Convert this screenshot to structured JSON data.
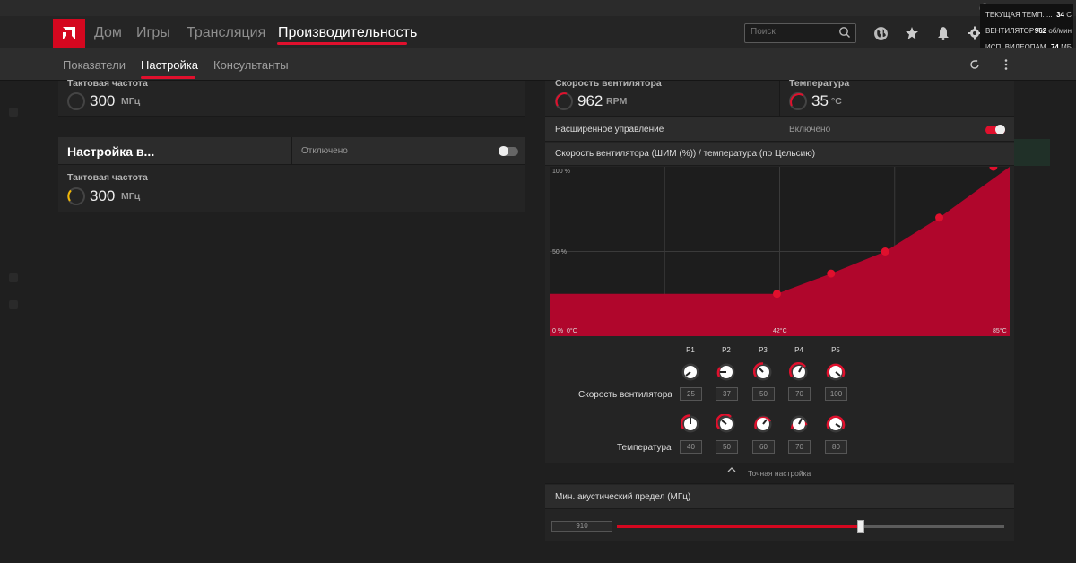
{
  "nav": {
    "items": [
      "Дом",
      "Игры",
      "Трансляция",
      "Производительность"
    ],
    "search_placeholder": "Поиск"
  },
  "overlay": {
    "rows": [
      {
        "label": "ТЕКУЩАЯ ТЕМП. ...",
        "value": "34",
        "unit": "C"
      },
      {
        "label": "ВЕНТИЛЯТОР Г...",
        "value": "962",
        "unit": "об/мин"
      },
      {
        "label": "ИСП. ВИДЕОПАМ...",
        "value": "74",
        "unit": "МБ"
      }
    ]
  },
  "subnav": {
    "items": [
      "Показатели",
      "Настройка",
      "Консультанты"
    ]
  },
  "left": {
    "panel1": {
      "label": "Тактовая частота",
      "value": "300",
      "unit": "МГц"
    },
    "panel2": {
      "title": "Настройка в...",
      "status": "Отключено",
      "label": "Тактовая частота",
      "value": "300",
      "unit": "МГц"
    }
  },
  "right": {
    "fan_speed": {
      "label": "Скорость вентилятора",
      "value": "962",
      "unit": "RPM"
    },
    "temperature": {
      "label": "Температура",
      "value": "35",
      "unit": "°C"
    },
    "advanced": {
      "label": "Расширенное управление",
      "status": "Включено"
    },
    "chart_title": "Скорость вентилятора (ШИМ (%)) / температура (по Цельсию)",
    "fine_tune": "Точная настройка",
    "min_acoustic": {
      "label": "Мин. акустический предел (МГц)",
      "value": "910",
      "fraction": 0.63
    },
    "points_header": [
      "P1",
      "P2",
      "P3",
      "P4",
      "P5"
    ],
    "fan_row_label": "Скорость вентилятора",
    "temp_row_label": "Температура",
    "fan_values": [
      "25",
      "37",
      "50",
      "70",
      "100"
    ],
    "temp_values": [
      "40",
      "50",
      "60",
      "70",
      "80"
    ]
  },
  "chart_data": {
    "type": "area",
    "x": [
      0,
      42,
      52,
      62,
      72,
      85
    ],
    "y": [
      25,
      25,
      37,
      50,
      70,
      100
    ],
    "points": [
      {
        "x": 42,
        "y": 25
      },
      {
        "x": 52,
        "y": 37
      },
      {
        "x": 62,
        "y": 50
      },
      {
        "x": 72,
        "y": 70
      },
      {
        "x": 82,
        "y": 100
      }
    ],
    "xlim": [
      0,
      85
    ],
    "ylim": [
      0,
      100
    ],
    "y_tick_labels": [
      "100 %",
      "50 %",
      "0 %"
    ],
    "x_tick_labels": [
      "0°C",
      "42°C",
      "85°C"
    ],
    "grid": true,
    "fill_color": "#b0062c",
    "point_color": "#e0102d"
  },
  "colors": {
    "accent": "#e0102d",
    "brand": "#d4071f"
  }
}
